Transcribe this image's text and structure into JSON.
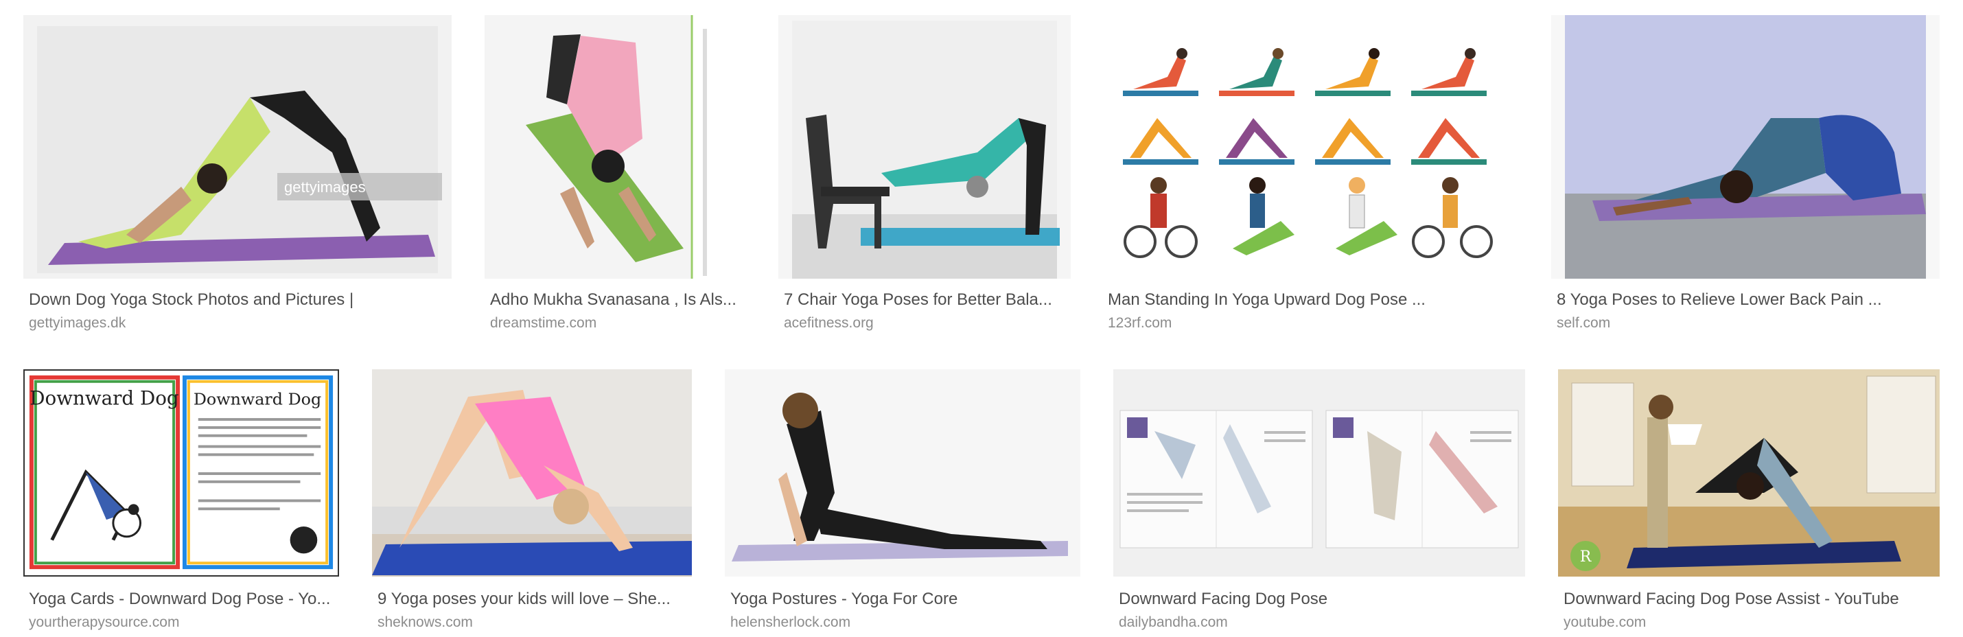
{
  "results": [
    {
      "title": "Down Dog Yoga Stock Photos and Pictures |",
      "source": "gettyimages.dk",
      "thumb_icon": "downward-dog-photo-thumbnail",
      "watermark": "gettyimages"
    },
    {
      "title": "Adho Mukha Svanasana , Is Als...",
      "source": "dreamstime.com",
      "thumb_icon": "downward-dog-top-view-thumbnail"
    },
    {
      "title": "7 Chair Yoga Poses for Better Bala...",
      "source": "acefitness.org",
      "thumb_icon": "chair-yoga-thumbnail"
    },
    {
      "title": "Man Standing In Yoga Upward Dog Pose ...",
      "source": "123rf.com",
      "thumb_icon": "yoga-illustration-grid-thumbnail"
    },
    {
      "title": "8 Yoga Poses to Relieve Lower Back Pain ...",
      "source": "self.com",
      "thumb_icon": "childs-pose-thumbnail"
    },
    {
      "title": "Yoga Cards - Downward Dog Pose - Yo...",
      "source": "yourtherapysource.com",
      "thumb_icon": "yoga-card-thumbnail",
      "card_heading": "Downward Dog"
    },
    {
      "title": "9 Yoga poses your kids will love – She...",
      "source": "sheknows.com",
      "thumb_icon": "kid-yoga-thumbnail"
    },
    {
      "title": "Yoga Postures - Yoga For Core",
      "source": "helensherlock.com",
      "thumb_icon": "cobra-pose-thumbnail"
    },
    {
      "title": "Downward Facing Dog Pose",
      "source": "dailybandha.com",
      "thumb_icon": "anatomy-book-thumbnail"
    },
    {
      "title": "Downward Facing Dog Pose Assist - YouTube",
      "source": "youtube.com",
      "thumb_icon": "assist-video-thumbnail",
      "watermark": "R"
    }
  ]
}
